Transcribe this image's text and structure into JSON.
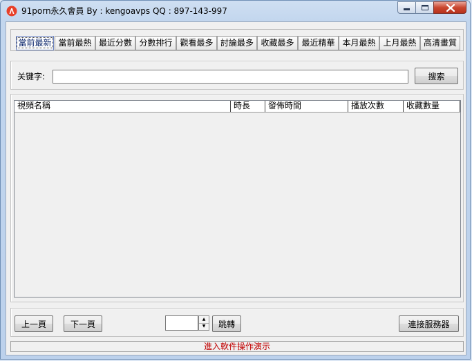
{
  "window": {
    "title": "91porn永久會員 By : kengoavps QQ : 897-143-997"
  },
  "tabs": [
    {
      "label": "當前最新",
      "active": true
    },
    {
      "label": "當前最熱"
    },
    {
      "label": "最近分數"
    },
    {
      "label": "分數排行"
    },
    {
      "label": "觀看最多"
    },
    {
      "label": "討論最多"
    },
    {
      "label": "收藏最多"
    },
    {
      "label": "最近精華"
    },
    {
      "label": "本月最熱"
    },
    {
      "label": "上月最熱"
    },
    {
      "label": "高清畫質"
    }
  ],
  "search": {
    "label": "关键字:",
    "value": "",
    "button_label": "搜索"
  },
  "list": {
    "columns": [
      "視頻名稱",
      "時長",
      "發佈時間",
      "播放次數",
      "收藏數量"
    ],
    "rows": []
  },
  "pager": {
    "prev_label": "上一頁",
    "next_label": "下一頁",
    "page_value": "",
    "jump_label": "跳轉",
    "connect_label": "連接服務器"
  },
  "status": {
    "text": "進入軟件操作演示"
  }
}
